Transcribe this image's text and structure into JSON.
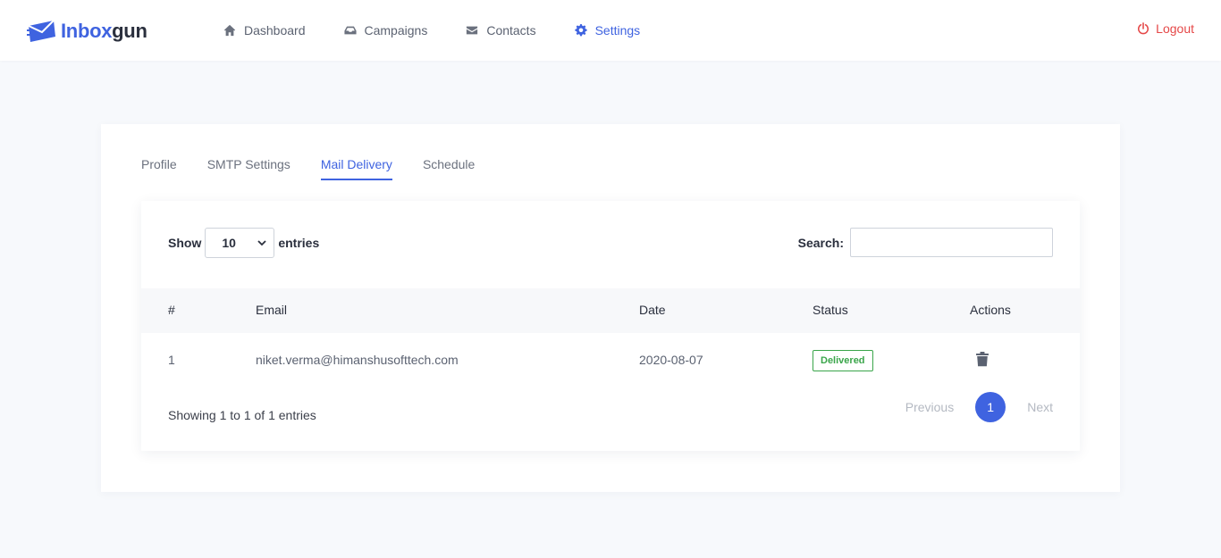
{
  "brand": {
    "name_part1": "Inbox",
    "name_part2": "gun",
    "accent": "#3f63e0"
  },
  "nav": [
    {
      "label": "Dashboard",
      "icon": "home-icon"
    },
    {
      "label": "Campaigns",
      "icon": "inbox-icon"
    },
    {
      "label": "Contacts",
      "icon": "envelope-icon"
    },
    {
      "label": "Settings",
      "icon": "gear-icon",
      "active": true
    }
  ],
  "logout": {
    "label": "Logout",
    "icon": "power-icon",
    "color": "#e54848"
  },
  "tabs": [
    {
      "label": "Profile"
    },
    {
      "label": "SMTP Settings"
    },
    {
      "label": "Mail Delivery",
      "active": true
    },
    {
      "label": "Schedule"
    }
  ],
  "table_controls": {
    "show_label": "Show",
    "entries_value": "10",
    "entries_label": "entries",
    "search_label": "Search:",
    "search_value": ""
  },
  "table": {
    "columns": [
      "#",
      "Email",
      "Date",
      "Status",
      "Actions"
    ],
    "rows": [
      {
        "num": "1",
        "email": "niket.verma@himanshusofttech.com",
        "date": "2020-08-07",
        "status": "Delivered",
        "action_icon": "trash-icon"
      }
    ]
  },
  "footer": {
    "info": "Showing 1 to 1 of 1 entries",
    "previous": "Previous",
    "current_page": "1",
    "next": "Next"
  },
  "colors": {
    "status_delivered": "#3aa54a",
    "logout": "#e54848"
  }
}
